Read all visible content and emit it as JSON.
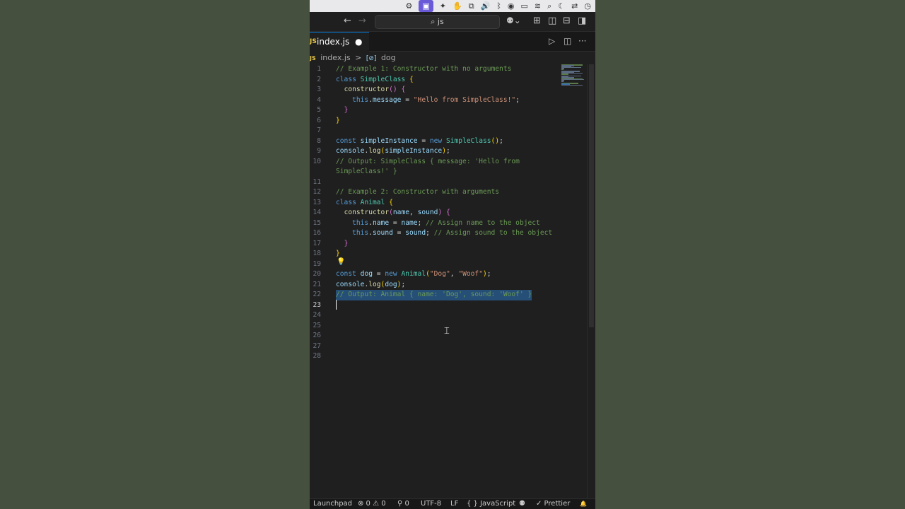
{
  "menubar": {
    "items": [
      "⚙",
      "▣",
      "✦",
      "✋",
      "⧉",
      "🔊",
      "ᛒ",
      "◉",
      "▭",
      "≋",
      "⌕",
      "☾",
      "⇄",
      "◷"
    ]
  },
  "titlebar": {
    "back_icon": "←",
    "forward_icon": "→",
    "search_text": "⌕ js",
    "copilot_icon": "⚉⌄",
    "layout_icons": [
      "⊞",
      "◫",
      "⊟",
      "◨"
    ]
  },
  "tab": {
    "badge": "JS",
    "label": "index.js",
    "dirty": "●",
    "run_icon": "▷",
    "split_icon": "◫",
    "more_icon": "···"
  },
  "breadcrumb": {
    "badge": "JS",
    "file": "index.js",
    "separator": ">",
    "symbol_icon": "[⊘]",
    "symbol": "dog"
  },
  "editor": {
    "current_line": 23,
    "selected_line": 22,
    "lines": [
      {
        "n": "1",
        "t": "// Example 1: Constructor with no arguments"
      },
      {
        "n": "2",
        "t": "class SimpleClass {"
      },
      {
        "n": "3",
        "t": "  constructor() {"
      },
      {
        "n": "4",
        "t": "    this.message = \"Hello from SimpleClass!\";"
      },
      {
        "n": "5",
        "t": "  }"
      },
      {
        "n": "6",
        "t": "}"
      },
      {
        "n": "7",
        "t": ""
      },
      {
        "n": "8",
        "t": "const simpleInstance = new SimpleClass();"
      },
      {
        "n": "9",
        "t": "console.log(simpleInstance);"
      },
      {
        "n": "10",
        "t": "// Output: SimpleClass { message: 'Hello from"
      },
      {
        "n": "",
        "t": "SimpleClass!' }"
      },
      {
        "n": "11",
        "t": ""
      },
      {
        "n": "12",
        "t": "// Example 2: Constructor with arguments"
      },
      {
        "n": "13",
        "t": "class Animal {"
      },
      {
        "n": "14",
        "t": "  constructor(name, sound) {"
      },
      {
        "n": "15",
        "t": "    this.name = name; // Assign name to the object"
      },
      {
        "n": "16",
        "t": "    this.sound = sound; // Assign sound to the object"
      },
      {
        "n": "17",
        "t": "  }"
      },
      {
        "n": "18",
        "t": "}"
      },
      {
        "n": "19",
        "t": ""
      },
      {
        "n": "20",
        "t": "const dog = new Animal(\"Dog\", \"Woof\");"
      },
      {
        "n": "21",
        "t": "console.log(dog);"
      },
      {
        "n": "22",
        "t": "// Output: Animal { name: 'Dog', sound: 'Woof' }"
      },
      {
        "n": "23",
        "t": ""
      },
      {
        "n": "24",
        "t": ""
      },
      {
        "n": "25",
        "t": ""
      },
      {
        "n": "26",
        "t": ""
      },
      {
        "n": "27",
        "t": ""
      },
      {
        "n": "28",
        "t": ""
      }
    ]
  },
  "statusbar": {
    "launchpad": "Launchpad",
    "problems": "⊗ 0 ⚠ 0",
    "ports": "⚲ 0",
    "encoding": "UTF-8",
    "eol": "LF",
    "language": "{ } JavaScript",
    "copilot": "⚉",
    "prettier": "✓ Prettier",
    "bell": "🔔"
  },
  "colors": {
    "accent": "#0078d4",
    "selection": "#264f78",
    "editor_bg": "#1f1f1f",
    "outer_bg": "#45503f"
  }
}
